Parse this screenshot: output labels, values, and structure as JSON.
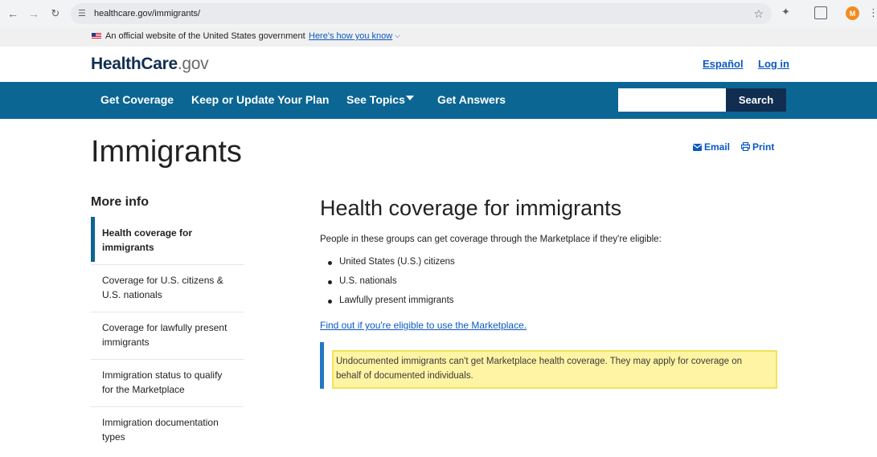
{
  "browser": {
    "url": "healthcare.gov/immigrants/",
    "profile_initial": "M"
  },
  "gov_banner": {
    "text": "An official website of the United States government",
    "link": "Here's how you know"
  },
  "header": {
    "logo_health": "Health",
    "logo_care": "Care",
    "logo_gov": ".gov",
    "espanol": "Español",
    "login": "Log in"
  },
  "nav": {
    "items": [
      "Get Coverage",
      "Keep or Update Your Plan",
      "See Topics",
      "Get Answers"
    ],
    "search_value": "",
    "search_button": "Search"
  },
  "page": {
    "title": "Immigrants",
    "email": "Email",
    "print": "Print"
  },
  "sidebar": {
    "title": "More info",
    "items": [
      {
        "line1": "Health coverage for",
        "line2": "immigrants"
      },
      {
        "line1": "Coverage for U.S. citizens &",
        "line2": "U.S. nationals"
      },
      {
        "line1": "Coverage for lawfully present",
        "line2": "immigrants"
      },
      {
        "line1": "Immigration status to qualify",
        "line2": "for the Marketplace"
      },
      {
        "line1": "Immigration documentation",
        "line2": "types"
      }
    ]
  },
  "content": {
    "title": "Health coverage for immigrants",
    "intro": "People in these groups can get coverage through the Marketplace if they're eligible:",
    "bullets": [
      "United States (U.S.) citizens",
      "U.S. nationals",
      "Lawfully present immigrants"
    ],
    "eligible_link": "Find out if you're eligible to use the Marketplace.",
    "alert_line1": "Undocumented immigrants can't get Marketplace health coverage. They may apply for coverage on",
    "alert_line2": "behalf of documented individuals."
  },
  "colors": {
    "nav_background": "#0b6693",
    "link": "#0b59c2",
    "alert_highlight": "#fff4a3",
    "alert_accent": "#2378c3"
  }
}
